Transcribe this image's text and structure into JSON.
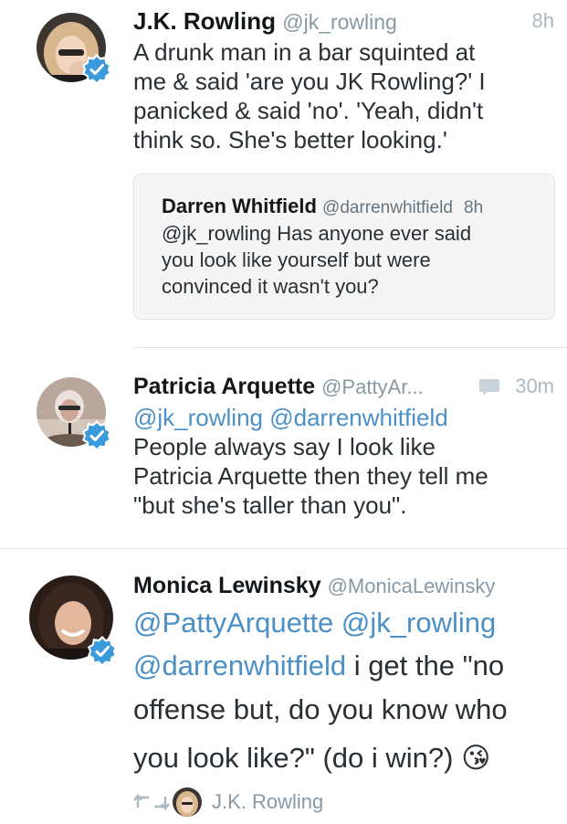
{
  "tweets": [
    {
      "name": "J.K. Rowling",
      "handle": "@jk_rowling",
      "time": "8h",
      "avatar": "jk-rowling-avatar",
      "verified": true,
      "text_lines": [
        "A drunk man in a bar squinted at",
        "me & said 'are you JK Rowling?' I",
        "panicked & said 'no'. 'Yeah, didn't",
        "think so. She's better looking.'"
      ],
      "quote": {
        "name": "Darren Whitfield",
        "handle": "@darrenwhitfield",
        "time": "8h",
        "text_lines": [
          "@jk_rowling Has anyone ever said",
          "you look like yourself but were",
          "convinced it wasn't you?"
        ]
      }
    },
    {
      "name": "Patricia Arquette",
      "handle": "@PattyAr...",
      "time": "30m",
      "avatar": "patricia-arquette-avatar",
      "verified": true,
      "reply_icon": "speech-bubble-icon",
      "mentions_line": "@jk_rowling @darrenwhitfield",
      "text_lines": [
        "People always say I look like",
        "Patricia Arquette then they tell me",
        "\"but she's taller than you\"."
      ]
    },
    {
      "name": "Monica Lewinsky",
      "handle": "@MonicaLewinsky",
      "avatar": "monica-lewinsky-avatar",
      "verified": true,
      "mentions_line": "@PattyArquette @jk_rowling",
      "line2_mention": "@darrenwhitfield",
      "line2_text": " i get the \"no",
      "text_lines": [
        "offense but, do you know who",
        "you look like?\" (do i win?)"
      ],
      "emoji": "😘",
      "retweeted_by": {
        "icon": "retweet-icon",
        "name": "J.K. Rowling"
      }
    }
  ],
  "colors": {
    "link": "#4a90c7",
    "verified": "#3a9bdc",
    "muted": "#8899a6",
    "divider": "#dfe3e6"
  }
}
